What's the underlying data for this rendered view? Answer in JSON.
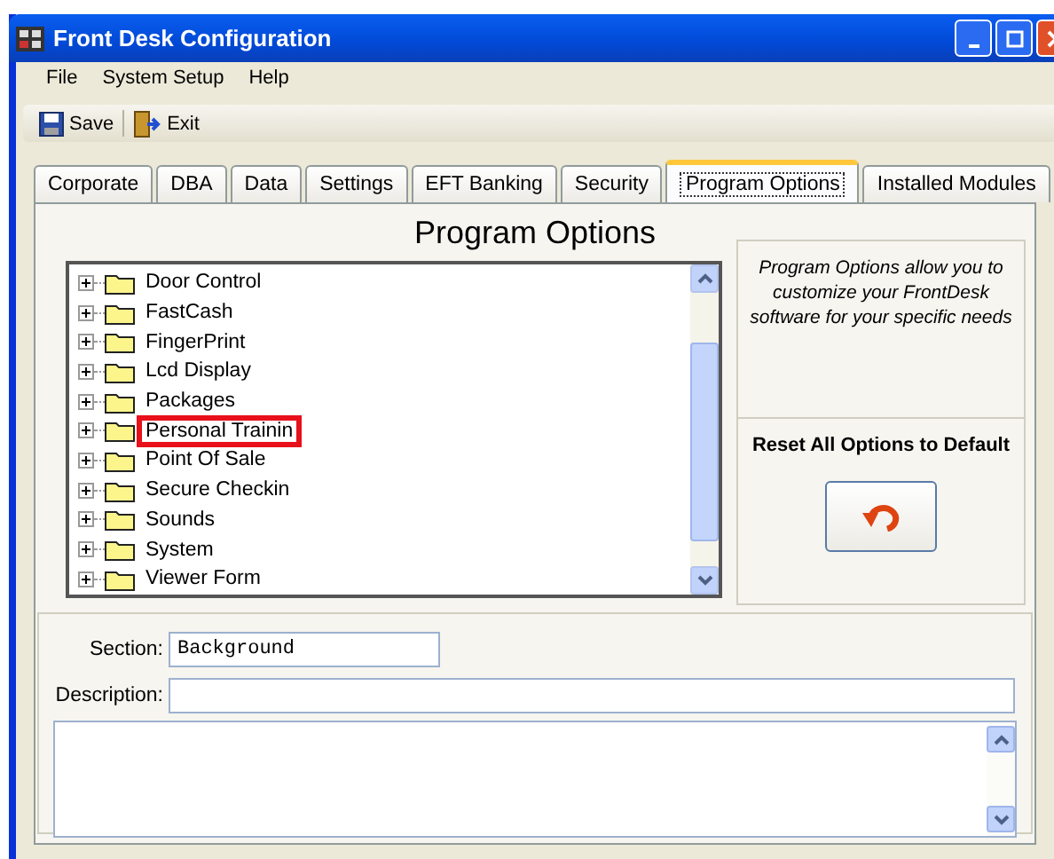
{
  "window": {
    "title": "Front Desk Configuration"
  },
  "menu": [
    "File",
    "System Setup",
    "Help"
  ],
  "toolbar": [
    {
      "label": "Save",
      "kind": "save"
    },
    {
      "label": "Exit",
      "kind": "exit"
    }
  ],
  "tabs": [
    {
      "label": "Corporate",
      "selected": false
    },
    {
      "label": "DBA",
      "selected": false
    },
    {
      "label": "Data",
      "selected": false
    },
    {
      "label": "Settings",
      "selected": false
    },
    {
      "label": "EFT Banking",
      "selected": false
    },
    {
      "label": "Security",
      "selected": false
    },
    {
      "label": "Program Options",
      "selected": true
    },
    {
      "label": "Installed Modules",
      "selected": false
    }
  ],
  "heading": "Program Options",
  "tree": [
    {
      "label": "Door Control",
      "expanded": false,
      "highlighted": false
    },
    {
      "label": "FastCash",
      "expanded": false,
      "highlighted": false
    },
    {
      "label": "FingerPrint",
      "expanded": false,
      "highlighted": false
    },
    {
      "label": "Lcd Display",
      "expanded": false,
      "highlighted": false
    },
    {
      "label": "Packages",
      "expanded": false,
      "highlighted": false
    },
    {
      "label": "Personal Trainin",
      "expanded": false,
      "highlighted": true
    },
    {
      "label": "Point Of Sale",
      "expanded": false,
      "highlighted": false
    },
    {
      "label": "Secure Checkin",
      "expanded": false,
      "highlighted": false
    },
    {
      "label": "Sounds",
      "expanded": false,
      "highlighted": false
    },
    {
      "label": "System",
      "expanded": false,
      "highlighted": false
    },
    {
      "label": "Viewer Form",
      "expanded": false,
      "highlighted": false
    }
  ],
  "info": "Program Options allow you to customize your FrontDesk software for your specific needs",
  "reset_label": "Reset All Options to Default",
  "section": {
    "label": "Section:",
    "value": "Background"
  },
  "description": {
    "label": "Description:"
  }
}
